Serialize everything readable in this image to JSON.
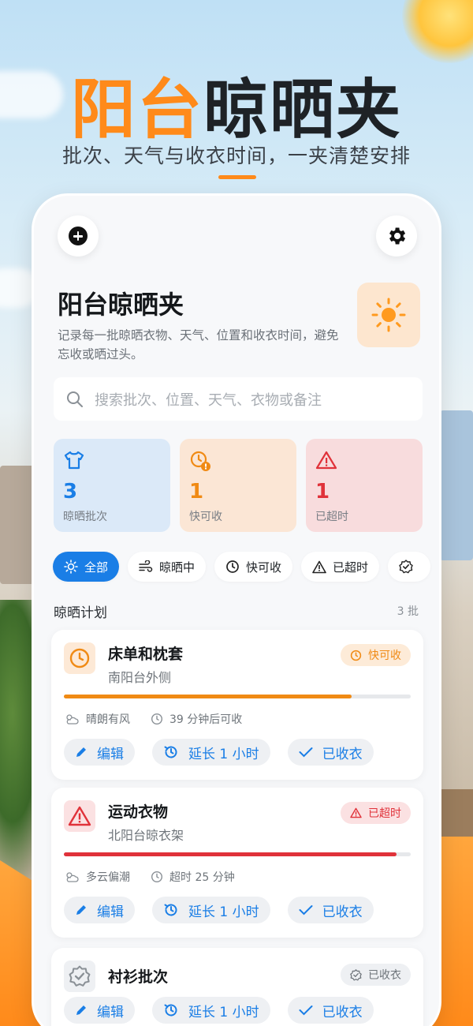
{
  "hero": {
    "title_accent": "阳台",
    "title_rest": "晾晒夹",
    "subtitle": "批次、天气与收衣时间，一夹清楚安排"
  },
  "app": {
    "title": "阳台晾晒夹",
    "description": "记录每一批晾晒衣物、天气、位置和收衣时间，避免忘收或晒过头。",
    "add_icon": "plus-circle-icon",
    "settings_icon": "gear-icon",
    "sun_icon": "sun-icon"
  },
  "search": {
    "placeholder": "搜索批次、位置、天气、衣物或备注"
  },
  "stats": [
    {
      "value": "3",
      "label": "晾晒批次",
      "icon": "shirt-icon",
      "color": "#1a7ee6"
    },
    {
      "value": "1",
      "label": "快可收",
      "icon": "clock-alert-icon",
      "color": "#f08a14"
    },
    {
      "value": "1",
      "label": "已超时",
      "icon": "warning-icon",
      "color": "#e0323a"
    }
  ],
  "filters": [
    {
      "label": "全部",
      "icon": "sun-icon",
      "active": true
    },
    {
      "label": "晾晒中",
      "icon": "wind-icon",
      "active": false
    },
    {
      "label": "快可收",
      "icon": "clock-icon",
      "active": false
    },
    {
      "label": "已超时",
      "icon": "warning-icon",
      "active": false
    },
    {
      "label": "",
      "icon": "check-badge-icon",
      "active": false
    }
  ],
  "section": {
    "title": "晾晒计划",
    "count": "3 批"
  },
  "plans": [
    {
      "name": "床单和枕套",
      "location": "南阳台外侧",
      "status": "快可收",
      "status_color": "#f08a14",
      "progress": 0.83,
      "weather": "晴朗有风",
      "time_info": "39 分钟后可收"
    },
    {
      "name": "运动衣物",
      "location": "北阳台晾衣架",
      "status": "已超时",
      "status_color": "#e0323a",
      "progress": 0.96,
      "weather": "多云偏潮",
      "time_info": "超时 25 分钟"
    },
    {
      "name": "衬衫批次",
      "status": "已收衣",
      "status_color": "#8a9096"
    }
  ],
  "actions": {
    "edit": "编辑",
    "extend": "延长 1 小时",
    "collected": "已收衣"
  }
}
